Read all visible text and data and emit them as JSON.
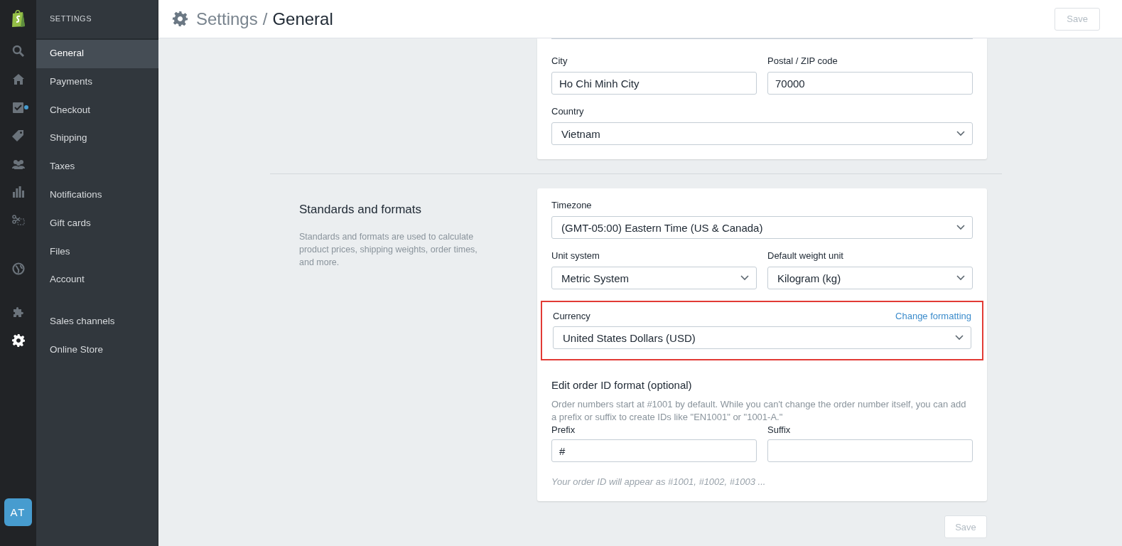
{
  "rail": {
    "icons": [
      {
        "kind": "logo",
        "selected": false,
        "dot": false
      },
      {
        "kind": "search",
        "selected": false,
        "dot": false
      },
      {
        "kind": "home",
        "selected": false,
        "dot": false
      },
      {
        "kind": "orders",
        "selected": false,
        "dot": true
      },
      {
        "kind": "tag",
        "selected": false,
        "dot": false
      },
      {
        "kind": "people",
        "selected": false,
        "dot": false
      },
      {
        "kind": "chart",
        "selected": false,
        "dot": false
      },
      {
        "kind": "scissors",
        "selected": false,
        "dot": false
      },
      {
        "kind": "globe",
        "selected": false,
        "dot": false
      },
      {
        "kind": "puzzle",
        "selected": false,
        "dot": false
      },
      {
        "kind": "gear",
        "selected": true,
        "dot": false
      }
    ],
    "avatar": "AT"
  },
  "sidebar": {
    "heading": "SETTINGS",
    "groups": [
      [
        {
          "label": "General",
          "selected": true
        },
        {
          "label": "Payments",
          "selected": false
        },
        {
          "label": "Checkout",
          "selected": false
        },
        {
          "label": "Shipping",
          "selected": false
        },
        {
          "label": "Taxes",
          "selected": false
        },
        {
          "label": "Notifications",
          "selected": false
        },
        {
          "label": "Gift cards",
          "selected": false
        },
        {
          "label": "Files",
          "selected": false
        },
        {
          "label": "Account",
          "selected": false
        }
      ],
      [
        {
          "label": "Sales channels",
          "selected": false
        },
        {
          "label": "Online Store",
          "selected": false
        }
      ]
    ]
  },
  "header": {
    "parent": "Settings",
    "separator": "/",
    "title": "General",
    "save": {
      "label": "Save",
      "disabled": true
    }
  },
  "address_card": {
    "rows": [
      [
        {
          "label": "City",
          "value": "Ho Chi Minh City",
          "kind": "text"
        },
        {
          "label": "Postal / ZIP code",
          "value": "70000",
          "kind": "text"
        }
      ],
      [
        {
          "label": "Country",
          "value": "Vietnam",
          "kind": "select"
        }
      ]
    ]
  },
  "standards": {
    "title": "Standards and formats",
    "description": "Standards and formats are used to calculate product prices, shipping weights, order times, and more.",
    "rows": [
      [
        {
          "label": "Timezone",
          "value": "(GMT-05:00) Eastern Time (US & Canada)",
          "kind": "select"
        }
      ],
      [
        {
          "label": "Unit system",
          "value": "Metric System",
          "kind": "select"
        },
        {
          "label": "Default weight unit",
          "value": "Kilogram (kg)",
          "kind": "select"
        }
      ]
    ],
    "currency": {
      "label": "Currency",
      "link": "Change formatting",
      "value": "United States Dollars (USD)",
      "highlighted": true
    },
    "order_id": {
      "title": "Edit order ID format (optional)",
      "description": "Order numbers start at #1001 by default. While you can't change the order number itself, you can add a prefix or suffix to create IDs like \"EN1001\" or \"1001-A.\"",
      "fields": [
        {
          "label": "Prefix",
          "value": "#",
          "kind": "text"
        },
        {
          "label": "Suffix",
          "kind": "text"
        }
      ],
      "preview": "Your order ID will appear as #1001, #1002, #1003 ..."
    }
  },
  "footer_save": {
    "label": "Save",
    "disabled": true
  }
}
